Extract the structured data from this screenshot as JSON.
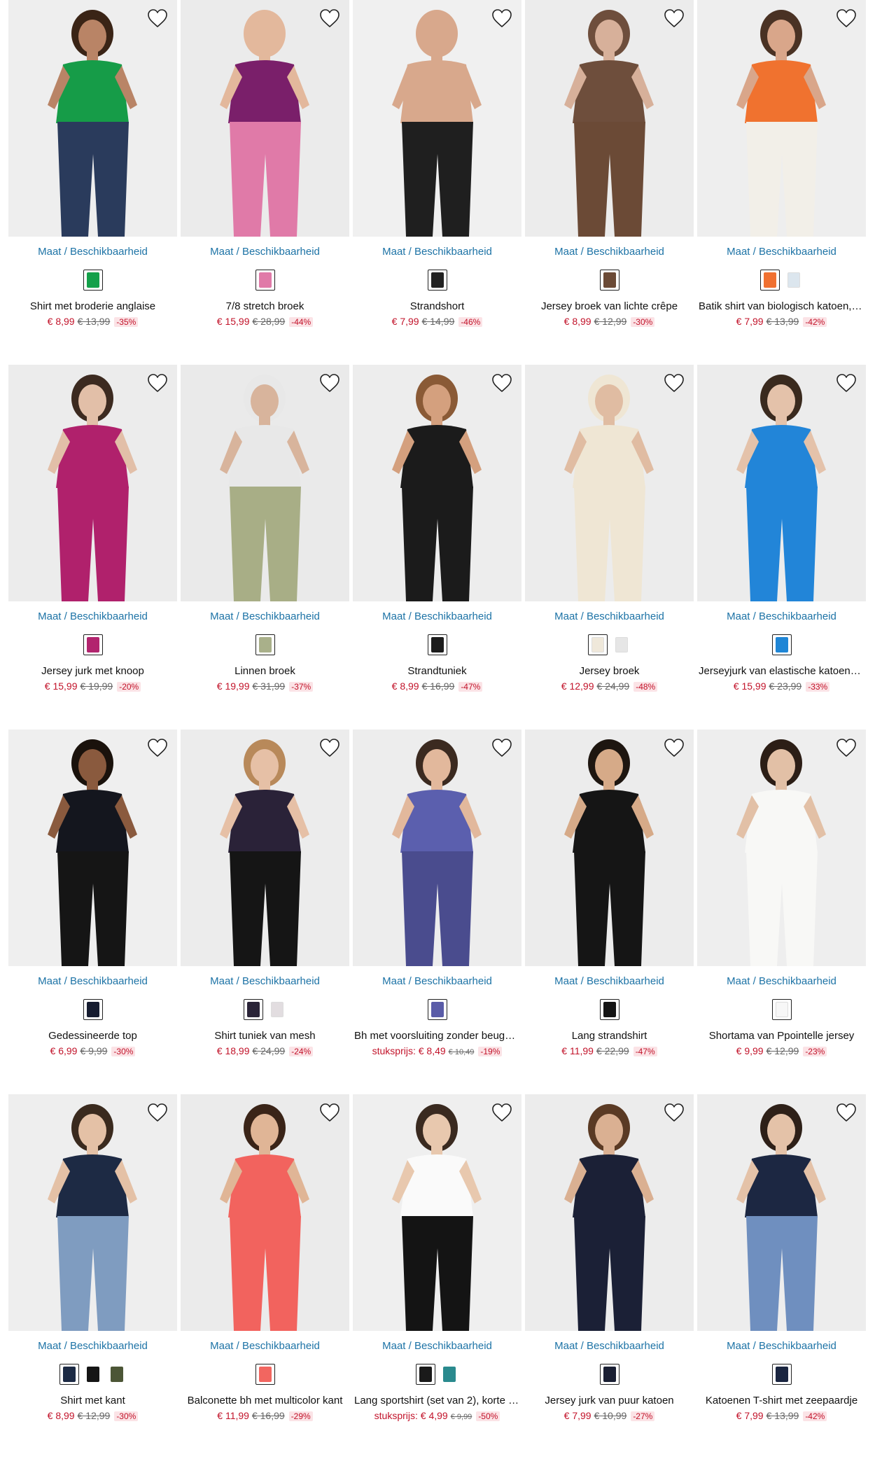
{
  "availability_label": "Maat / Beschikbaarheid",
  "products": [
    {
      "name": "Shirt met broderie anglaise",
      "price": "€ 8,99",
      "was": "€ 13,99",
      "discount": "-35%",
      "unit_label": "",
      "swatches": [
        "#14a04a"
      ],
      "bg": "#eeeeee",
      "top": "#169c48",
      "bottom": "#2a3b5c",
      "skin": "#b98466",
      "hair": "#3a2416"
    },
    {
      "name": "7/8 stretch broek",
      "price": "€ 15,99",
      "was": "€ 28,99",
      "discount": "-44%",
      "unit_label": "",
      "swatches": [
        "#e07aa8"
      ],
      "bg": "#ebebeb",
      "top": "#7a1f6a",
      "bottom": "#e07aa8",
      "skin": "#e3b89c",
      "hair": "#e3b89c"
    },
    {
      "name": "Strandshort",
      "price": "€ 7,99",
      "was": "€ 14,99",
      "discount": "-46%",
      "unit_label": "",
      "swatches": [
        "#222222"
      ],
      "bg": "#f0f0f0",
      "top": "#d8a88c",
      "bottom": "#1f1f1f",
      "skin": "#d8a88c",
      "hair": "#d8a88c"
    },
    {
      "name": "Jersey broek van lichte crêpe",
      "price": "€ 8,99",
      "was": "€ 12,99",
      "discount": "-30%",
      "unit_label": "",
      "swatches": [
        "#6b4a36"
      ],
      "bg": "#ececec",
      "top": "#6e4e3c",
      "bottom": "#6b4a36",
      "skin": "#d7b09a",
      "hair": "#6e4e3c"
    },
    {
      "name": "Batik shirt van biologisch katoen, h…",
      "price": "€ 7,99",
      "was": "€ 13,99",
      "discount": "-42%",
      "unit_label": "",
      "swatches": [
        "#f07030",
        "#dce6ee"
      ],
      "bg": "#eeeeee",
      "top": "#f0722f",
      "bottom": "#f2efe8",
      "skin": "#d9a68a",
      "hair": "#4a3224"
    },
    {
      "name": "Jersey jurk met knoop",
      "price": "€ 15,99",
      "was": "€ 19,99",
      "discount": "-20%",
      "unit_label": "",
      "swatches": [
        "#b2246e"
      ],
      "bg": "#ececec",
      "top": "#b0216c",
      "bottom": "#b0216c",
      "skin": "#e2bfa8",
      "hair": "#3c2a20"
    },
    {
      "name": "Linnen broek",
      "price": "€ 19,99",
      "was": "€ 31,99",
      "discount": "-37%",
      "unit_label": "",
      "swatches": [
        "#a9b08a"
      ],
      "bg": "#eaeaea",
      "top": "#e8e8e8",
      "bottom": "#a8ae86",
      "skin": "#d8b49c",
      "hair": "#e8e8e8"
    },
    {
      "name": "Strandtuniek",
      "price": "€ 8,99",
      "was": "€ 16,99",
      "discount": "-47%",
      "unit_label": "",
      "swatches": [
        "#1c1c1c"
      ],
      "bg": "#ededed",
      "top": "#1b1b1b",
      "bottom": "#1b1b1b",
      "skin": "#d4a07e",
      "hair": "#8a5a36"
    },
    {
      "name": "Jersey broek",
      "price": "€ 12,99",
      "was": "€ 24,99",
      "discount": "-48%",
      "unit_label": "",
      "swatches": [
        "#efe8da",
        "#e6e6e6"
      ],
      "bg": "#ececec",
      "top": "#efe6d4",
      "bottom": "#efe6d4",
      "skin": "#e0bca2",
      "hair": "#efe6d4"
    },
    {
      "name": "Jerseyjurk van elastische katoenmi…",
      "price": "€ 15,99",
      "was": "€ 23,99",
      "discount": "-33%",
      "unit_label": "",
      "swatches": [
        "#1f86d6"
      ],
      "bg": "#ececec",
      "top": "#2285d8",
      "bottom": "#2285d8",
      "skin": "#e4c2aa",
      "hair": "#3a2a1e"
    },
    {
      "name": "Gedessineerde top",
      "price": "€ 6,99",
      "was": "€ 9,99",
      "discount": "-30%",
      "unit_label": "",
      "swatches": [
        "#161c30"
      ],
      "bg": "#efefef",
      "top": "#14161e",
      "bottom": "#151515",
      "skin": "#8a5a3e",
      "hair": "#1a120c"
    },
    {
      "name": "Shirt tuniek van mesh",
      "price": "€ 18,99",
      "was": "€ 24,99",
      "discount": "-24%",
      "unit_label": "",
      "swatches": [
        "#2a2438",
        "#e2dde0"
      ],
      "bg": "#ececec",
      "top": "#2a2238",
      "bottom": "#151515",
      "skin": "#e6c0a6",
      "hair": "#b8895a"
    },
    {
      "name": "Bh met voorsluiting zonder beugel …",
      "price": "€ 8,49",
      "was": "€ 10,49",
      "discount": "-19%",
      "unit_label": "stuksprijs:",
      "swatches": [
        "#5a5ca8"
      ],
      "bg": "#ededed",
      "top": "#5b5fae",
      "bottom": "#4a4c8e",
      "skin": "#e2b89c",
      "hair": "#3b2a20"
    },
    {
      "name": "Lang strandshirt",
      "price": "€ 11,99",
      "was": "€ 22,99",
      "discount": "-47%",
      "unit_label": "",
      "swatches": [
        "#141414"
      ],
      "bg": "#ececec",
      "top": "#151515",
      "bottom": "#151515",
      "skin": "#d6aa88",
      "hair": "#1e1610"
    },
    {
      "name": "Shortama van Ppointelle jersey",
      "price": "€ 9,99",
      "was": "€ 12,99",
      "discount": "-23%",
      "unit_label": "",
      "swatches": [
        "#f7f7f7"
      ],
      "bg": "#eeeeee",
      "top": "#f8f8f6",
      "bottom": "#f8f8f6",
      "skin": "#e2c0a6",
      "hair": "#2c1e16"
    },
    {
      "name": "Shirt met kant",
      "price": "€ 8,99",
      "was": "€ 12,99",
      "discount": "-30%",
      "unit_label": "",
      "swatches": [
        "#1c2a44",
        "#151515",
        "#4c5636"
      ],
      "bg": "#eeeeee",
      "top": "#1d2a44",
      "bottom": "#7f9cc0",
      "skin": "#e4c1a6",
      "hair": "#3a2a1e"
    },
    {
      "name": "Balconette bh met multicolor kant",
      "price": "€ 11,99",
      "was": "€ 16,99",
      "discount": "-29%",
      "unit_label": "",
      "swatches": [
        "#f26660"
      ],
      "bg": "#ebebeb",
      "top": "#f2635e",
      "bottom": "#f2635e",
      "skin": "#e0b596",
      "hair": "#3a2418"
    },
    {
      "name": "Lang sportshirt (set van 2), korte m…",
      "price": "€ 4,99",
      "was": "€ 9,99",
      "discount": "-50%",
      "unit_label": "stuksprijs:",
      "swatches": [
        "#1a1a1a",
        "#2a8a8e"
      ],
      "bg": "#efefef",
      "top": "#fafafa",
      "bottom": "#141414",
      "skin": "#e8c8ae",
      "hair": "#3a2a20"
    },
    {
      "name": "Jersey jurk van puur katoen",
      "price": "€ 7,99",
      "was": "€ 10,99",
      "discount": "-27%",
      "unit_label": "",
      "swatches": [
        "#1a1f33"
      ],
      "bg": "#ececec",
      "top": "#1b2036",
      "bottom": "#1b2036",
      "skin": "#dab092",
      "hair": "#5a3a24"
    },
    {
      "name": "Katoenen T-shirt met zeepaardje",
      "price": "€ 7,99",
      "was": "€ 13,99",
      "discount": "-42%",
      "unit_label": "",
      "swatches": [
        "#1a2540"
      ],
      "bg": "#ededed",
      "top": "#1c2742",
      "bottom": "#6f8fbf",
      "skin": "#e4c2a8",
      "hair": "#2e2018"
    }
  ]
}
